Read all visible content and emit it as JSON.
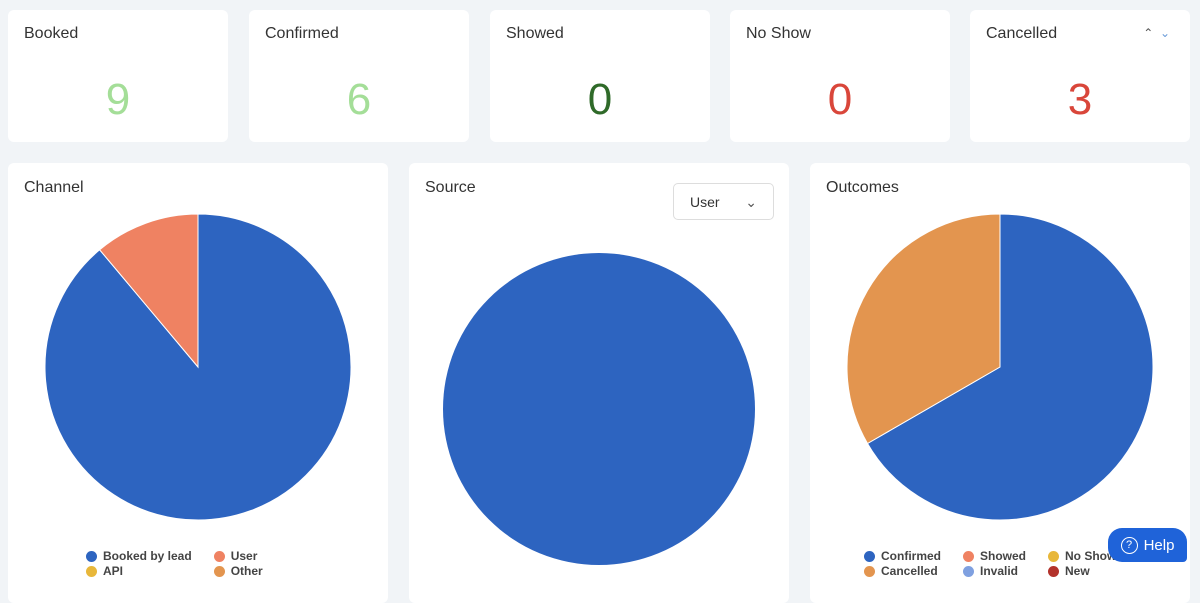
{
  "stats": [
    {
      "label": "Booked",
      "value": "9",
      "color": "#a4de98"
    },
    {
      "label": "Confirmed",
      "value": "6",
      "color": "#a4de98"
    },
    {
      "label": "Showed",
      "value": "0",
      "color": "#2f6a29"
    },
    {
      "label": "No Show",
      "value": "0",
      "color": "#d9463a"
    },
    {
      "label": "Cancelled",
      "value": "3",
      "color": "#d9463a"
    }
  ],
  "sort_icons": [
    "chevron-up-icon",
    "chevron-down-icon"
  ],
  "source_dropdown": {
    "value": "User"
  },
  "help": {
    "label": "Help"
  },
  "chart_data": [
    {
      "type": "pie",
      "title": "Channel",
      "categories": [
        "Booked by lead",
        "User",
        "API",
        "Other"
      ],
      "values": [
        8,
        1,
        0,
        0
      ],
      "colors": [
        "#2d64c0",
        "#ef8262",
        "#e8b73a",
        "#e3954f"
      ],
      "legend": "bottom"
    },
    {
      "type": "pie",
      "title": "Source",
      "categories": [
        ""
      ],
      "values": [
        9
      ],
      "colors": [
        "#2d64c0"
      ]
    },
    {
      "type": "pie",
      "title": "Outcomes",
      "categories": [
        "Confirmed",
        "Showed",
        "No Show",
        "Cancelled",
        "Invalid",
        "New"
      ],
      "values": [
        6,
        0,
        0,
        3,
        0,
        0
      ],
      "colors": [
        "#2d64c0",
        "#ef8262",
        "#e8b73a",
        "#e3954f",
        "#7fa0e0",
        "#b3322b"
      ],
      "legend": "bottom"
    }
  ]
}
